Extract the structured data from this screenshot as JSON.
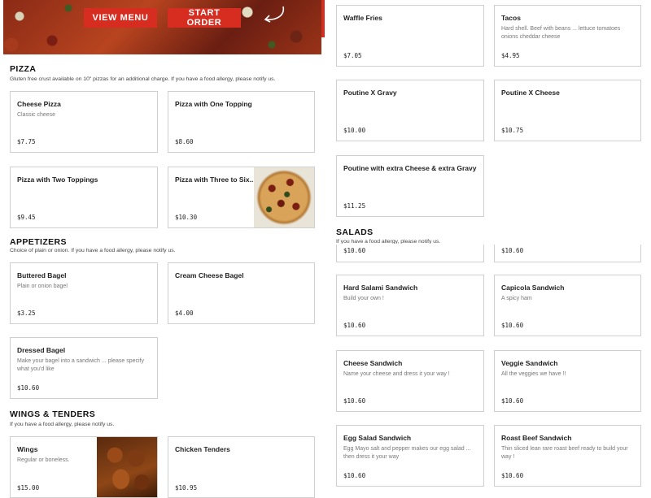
{
  "hero": {
    "view_menu_label": "VIEW MENU",
    "start_order_label": "START ORDER"
  },
  "pizza": {
    "title": "PIZZA",
    "note": "Gluten free crust available on 10\" pizzas for an additional charge. If you have a food allergy, please notify us.",
    "items": [
      {
        "name": "Cheese Pizza",
        "desc": "Classic cheese",
        "price": "$7.75"
      },
      {
        "name": "Pizza with One Topping",
        "desc": "",
        "price": "$8.60"
      },
      {
        "name": "Pizza with Two Toppings",
        "desc": "",
        "price": "$9.45"
      },
      {
        "name": "Pizza with Three to Six...",
        "desc": "",
        "price": "$10.30"
      }
    ]
  },
  "appetizers": {
    "title": "APPETIZERS",
    "note": "Choice of plain or onion. If you have a food allergy, please notify us.",
    "items": [
      {
        "name": "Buttered Bagel",
        "desc": "Plain or onion bagel",
        "price": "$3.25"
      },
      {
        "name": "Cream Cheese Bagel",
        "desc": "",
        "price": "$4.00"
      },
      {
        "name": "Dressed Bagel",
        "desc": "Make your bagel into a sandwich ... please specify what you'd like",
        "price": "$10.60"
      }
    ]
  },
  "wings": {
    "title": "WINGS & TENDERS",
    "note": "If you have a food allergy, please notify us.",
    "items": [
      {
        "name": "Wings",
        "desc": "Regular or boneless.",
        "price": "$15.00"
      },
      {
        "name": "Chicken Tenders",
        "desc": "",
        "price": "$10.95"
      }
    ]
  },
  "sides": {
    "items": [
      {
        "name": "Waffle Fries",
        "desc": "",
        "price": "$7.05"
      },
      {
        "name": "Tacos",
        "desc": "Hard shell. Beef with beans ... lettuce tomatoes onions cheddar cheese",
        "price": "$4.95"
      },
      {
        "name": "Poutine X Gravy",
        "desc": "",
        "price": "$10.00"
      },
      {
        "name": "Poutine X Cheese",
        "desc": "",
        "price": "$10.75"
      },
      {
        "name": "Poutine with extra Cheese & extra Gravy",
        "desc": "",
        "price": "$11.25"
      }
    ]
  },
  "salads": {
    "title": "SALADS",
    "note": "If you have a food allergy, please notify us."
  },
  "sandwiches": {
    "partial_prices": [
      "$10.60",
      "$10.60"
    ],
    "items": [
      {
        "name": "Hard Salami Sandwich",
        "desc": "Build your own !",
        "price": "$10.60"
      },
      {
        "name": "Capicola Sandwich",
        "desc": "A spicy ham",
        "price": "$10.60"
      },
      {
        "name": "Cheese Sandwich",
        "desc": "Name your cheese and dress it your way !",
        "price": "$10.60"
      },
      {
        "name": "Veggie Sandwich",
        "desc": "All the veggies we have !!",
        "price": "$10.60"
      },
      {
        "name": "Egg Salad Sandwich",
        "desc": "Egg Mayo salt and pepper makes our egg salad ... then dress it your way",
        "price": "$10.60"
      },
      {
        "name": "Roast Beef Sandwich",
        "desc": "Thin sliced lean rare roast beef ready to build your way !",
        "price": "$10.60"
      }
    ]
  },
  "colors": {
    "accent": "#d62d20",
    "border": "#cfcfcf"
  }
}
